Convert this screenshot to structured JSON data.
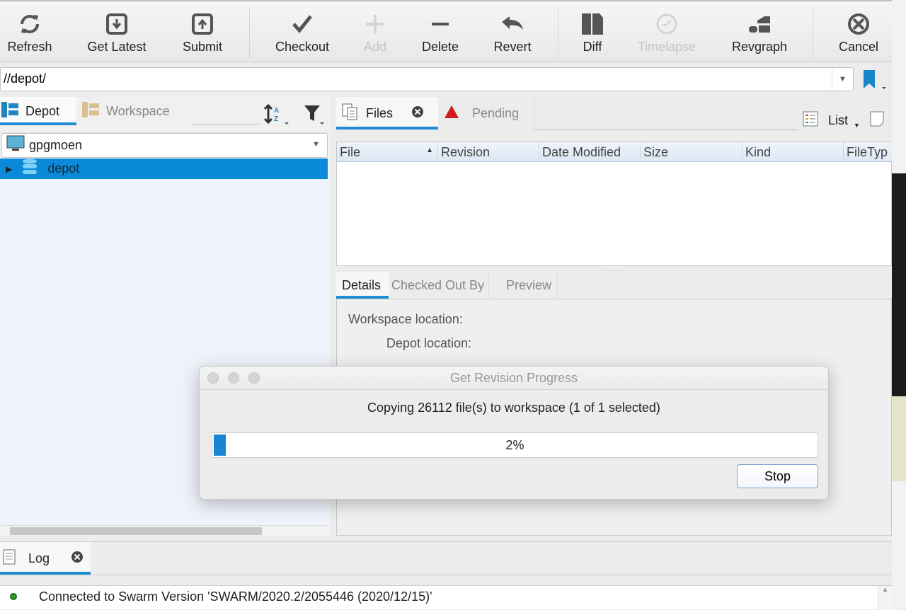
{
  "toolbar": {
    "refresh": "Refresh",
    "get_latest": "Get Latest",
    "submit": "Submit",
    "checkout": "Checkout",
    "add": "Add",
    "delete": "Delete",
    "revert": "Revert",
    "diff": "Diff",
    "timelapse": "Timelapse",
    "revgraph": "Revgraph",
    "cancel": "Cancel"
  },
  "address": {
    "value": "//depot/"
  },
  "left_panel": {
    "tabs": [
      {
        "label": "Depot"
      },
      {
        "label": "Workspace"
      }
    ],
    "workspace_select": "gpgmoen",
    "tree": [
      {
        "label": "depot",
        "selected": true
      }
    ]
  },
  "right_panel": {
    "tabs": [
      {
        "label": "Files"
      },
      {
        "label": "Pending"
      }
    ],
    "view_mode": "List",
    "columns": [
      "File",
      "Revision",
      "Date Modified",
      "Size",
      "Kind",
      "FileTyp"
    ],
    "detail_tabs": [
      "Details",
      "Checked Out By",
      "Preview"
    ],
    "detail_labels": [
      "Workspace location:",
      "Depot location:"
    ]
  },
  "log": {
    "tab_label": "Log",
    "entries": [
      {
        "text": "Connected to Swarm Version 'SWARM/2020.2/2055446 (2020/12/15)'",
        "status_color": "#2aa52a"
      }
    ]
  },
  "dialog": {
    "title": "Get Revision Progress",
    "message": "Copying 26112 file(s) to workspace (1 of 1 selected)",
    "progress_percent": 2,
    "progress_label": "2%",
    "stop_label": "Stop"
  },
  "colors": {
    "accent": "#1f8dd6",
    "selection": "#0a8ad8"
  }
}
